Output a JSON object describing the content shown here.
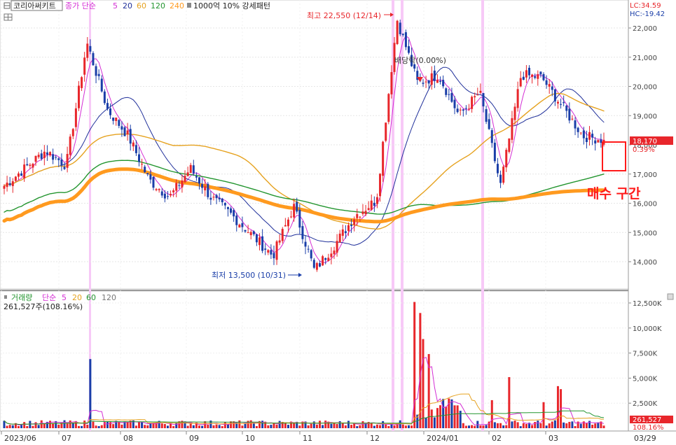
{
  "header": {
    "stock_name": "코리아써키트",
    "ma_label": "종가 단순",
    "ma_periods": [
      "5",
      "20",
      "60",
      "120",
      "240"
    ],
    "pattern_text": "1000억 10% 강세패턴"
  },
  "indicators": {
    "lc": "LC:34.59",
    "hc": "HC:-19.42"
  },
  "price_axis": {
    "ticks": [
      "22,000",
      "21,000",
      "20,000",
      "19,000",
      "18,000",
      "17,000",
      "16,000",
      "15,000",
      "14,000"
    ],
    "tick_values": [
      22000,
      21000,
      20000,
      19000,
      18000,
      17000,
      16000,
      15000,
      14000
    ],
    "current_price": "18,170",
    "current_change": "0.39%"
  },
  "annotations": {
    "high": "최고 22,550 (12/14)",
    "low": "최저 13,500 (10/31)",
    "ex_rights": "배당락(0.00%)",
    "buy_zone": "매수 구간"
  },
  "volume_panel": {
    "title": "거래량",
    "ma_label": "단순",
    "ma_periods": [
      "5",
      "20",
      "60",
      "120"
    ],
    "current": "261,527주(108.16%)",
    "axis_ticks": [
      "12,500K",
      "10,000K",
      "7,500K",
      "5,000K",
      "2,500K"
    ],
    "axis_values": [
      12500,
      10000,
      7500,
      5000,
      2500
    ],
    "current_value": "261,527",
    "current_pct": "108.16%"
  },
  "x_axis": {
    "labels": [
      "2023/06",
      "07",
      "08",
      "09",
      "10",
      "11",
      "12",
      "2024/01",
      "02",
      "03",
      "03/29"
    ]
  },
  "colors": {
    "up": "#e8262b",
    "down": "#1a3ea8",
    "ma5": "#d42ed4",
    "ma20": "#1f2f9a",
    "ma60": "#e6a21f",
    "ma120": "#23952f",
    "ma240": "#ff9a1f",
    "highlight": "#f7c9f7"
  },
  "chart_data": [
    {
      "type": "candlestick",
      "title": "코리아써키트",
      "ylim": [
        13200,
        22700
      ],
      "annotations": [
        "최고 22,550 (12/14)",
        "최저 13,500 (10/31)",
        "배당락(0.00%)",
        "매수 구간"
      ],
      "close_path": [
        [
          "2023/06 start",
          16600
        ],
        [
          "06 mid",
          17200
        ],
        [
          "06 late",
          17800
        ],
        [
          "07 early",
          17300
        ],
        [
          "07 spike",
          21500
        ],
        [
          "07 late",
          19200
        ],
        [
          "08 early",
          18300
        ],
        [
          "08 mid",
          16800
        ],
        [
          "08 late",
          16200
        ],
        [
          "09 early",
          17200
        ],
        [
          "09 mid",
          16200
        ],
        [
          "09 late",
          15600
        ],
        [
          "10 early",
          14900
        ],
        [
          "10 mid",
          14200
        ],
        [
          "10 late",
          15900
        ],
        [
          "10/31",
          13700
        ],
        [
          "11 mid",
          14600
        ],
        [
          "11 late",
          15600
        ],
        [
          "12 early",
          16100
        ],
        [
          "12/14",
          22300
        ],
        [
          "12 late",
          20100
        ],
        [
          "2024/01 early",
          20400
        ],
        [
          "01 mid",
          19000
        ],
        [
          "01 late",
          19800
        ],
        [
          "02 early",
          16600
        ],
        [
          "02 mid",
          20400
        ],
        [
          "02 late",
          20300
        ],
        [
          "03 early",
          19300
        ],
        [
          "03 mid",
          18300
        ],
        [
          "03/29",
          18170
        ]
      ],
      "moving_averages": [
        {
          "name": "5",
          "color": "#d42ed4"
        },
        {
          "name": "20",
          "color": "#1f2f9a"
        },
        {
          "name": "60",
          "color": "#e6a21f"
        },
        {
          "name": "120",
          "color": "#23952f"
        },
        {
          "name": "240",
          "color": "#ff9a1f"
        }
      ],
      "last_price": 18170,
      "last_change_pct": 0.39
    },
    {
      "type": "bar",
      "title": "거래량",
      "ylabel": "",
      "unit": "K",
      "ylim": [
        0,
        13000
      ],
      "notable_volumes": [
        {
          "period": "07 spike",
          "value": 6900
        },
        {
          "period": "12/14",
          "value": 12600
        },
        {
          "period": "12/15",
          "value": 11500
        },
        {
          "period": "02 early",
          "value": 5100
        },
        {
          "period": "02 mid",
          "value": 4200
        },
        {
          "period": "03/29",
          "value": 261.527
        }
      ],
      "last_volume": 261527,
      "last_volume_pct": 108.16
    }
  ]
}
